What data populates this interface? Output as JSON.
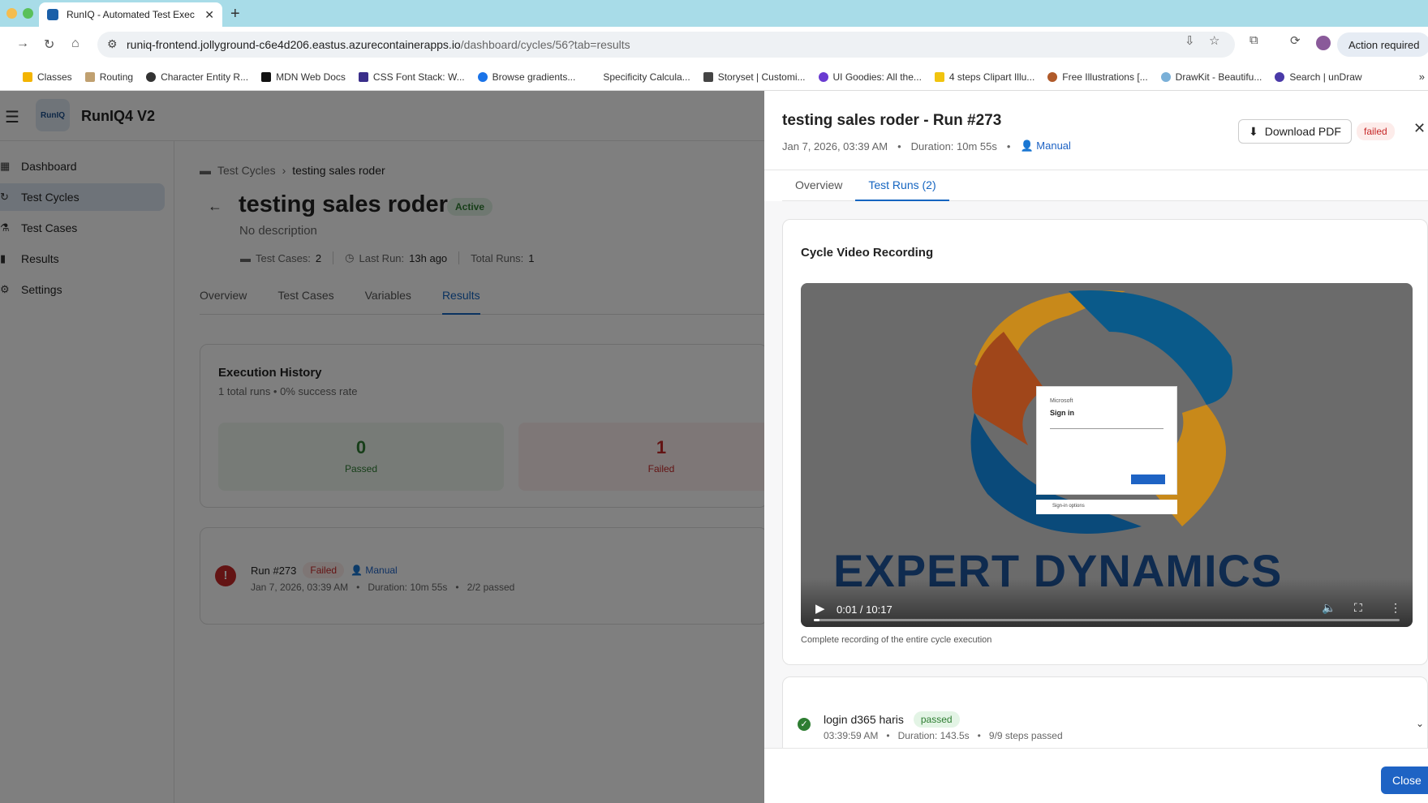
{
  "browser": {
    "tab_title": "RunIQ - Automated Test Exec",
    "url_host": "runiq-frontend.jollyground-c6e4d206.eastus.azurecontainerapps.io",
    "url_path": "/dashboard/cycles/56?tab=results",
    "action_required": "Action required",
    "bookmarks": [
      "Classes",
      "Routing",
      "Character Entity R...",
      "MDN Web Docs",
      "CSS Font Stack: W...",
      "Browse gradients...",
      "Specificity Calcula...",
      "Storyset | Customi...",
      "UI Goodies: All the...",
      "4 steps Clipart Illu...",
      "Free Illustrations [...",
      "DrawKit - Beautifu...",
      "Search | unDraw"
    ]
  },
  "app": {
    "brand": "RunIQ4 V2",
    "logo_text": "RunIQ",
    "nav": [
      "Dashboard",
      "Test Cycles",
      "Test Cases",
      "Results",
      "Settings"
    ],
    "active_nav": "Test Cycles"
  },
  "page": {
    "breadcrumb_root": "Test Cycles",
    "breadcrumb_current": "testing sales roder",
    "title": "testing sales roder",
    "status": "Active",
    "description": "No description",
    "test_cases_label": "Test Cases:",
    "test_cases_value": "2",
    "last_run_label": "Last Run:",
    "last_run_value": "13h ago",
    "total_runs_label": "Total Runs:",
    "total_runs_value": "1",
    "tabs": [
      "Overview",
      "Test Cases",
      "Variables",
      "Results"
    ],
    "active_tab": "Results"
  },
  "execution_history": {
    "title": "Execution History",
    "subtitle": "1 total runs • 0% success rate",
    "passed_value": "0",
    "passed_label": "Passed",
    "failed_value": "1",
    "failed_label": "Failed"
  },
  "run_item": {
    "title": "Run #273",
    "status": "Failed",
    "trigger": "Manual",
    "date": "Jan 7, 2026, 03:39 AM",
    "duration": "Duration: 10m 55s",
    "passed": "2/2 passed"
  },
  "drawer": {
    "title": "testing sales roder - Run #273",
    "date": "Jan 7, 2026, 03:39 AM",
    "duration": "Duration: 10m 55s",
    "trigger": "Manual",
    "download_label": "Download PDF",
    "status": "failed",
    "tabs": [
      "Overview",
      "Test Runs (2)"
    ],
    "active_tab": "Test Runs (2)",
    "video_title": "Cycle Video Recording",
    "video_time": "0:01 / 10:17",
    "video_progress": 0.01,
    "video_caption": "Complete recording of the entire cycle execution",
    "video_frame": {
      "ms_label": "Microsoft",
      "signin": "Sign in",
      "option": "Sign-in options",
      "brand_text": "EXPERT DYNAMICS"
    },
    "test_case": {
      "name": "login d365 haris",
      "status": "passed",
      "time": "03:39:59 AM",
      "duration": "Duration: 143.5s",
      "steps": "9/9 steps passed"
    },
    "close_label": "Close"
  },
  "colors": {
    "accent": "#1565c0",
    "failed": "#c62828",
    "passed": "#2e7d32"
  }
}
